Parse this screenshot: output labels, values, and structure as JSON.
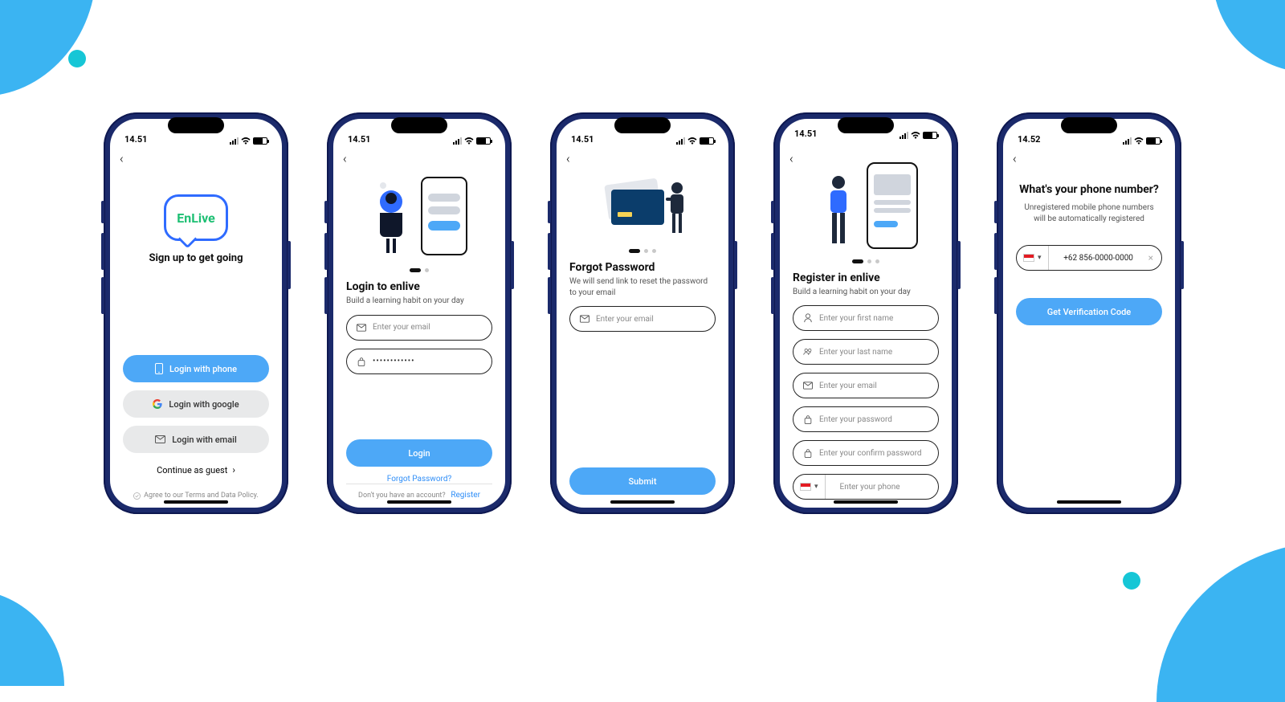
{
  "status": {
    "time1": "14.51",
    "time2": "14.52"
  },
  "colors": {
    "primary": "#4DA8F7",
    "accent": "#2F6BFF",
    "grey": "#E8E9EA"
  },
  "screen1": {
    "logo": "EnLive",
    "headline": "Sign up to get going",
    "login_phone": "Login with phone",
    "login_google": "Login with google",
    "login_email": "Login with email",
    "guest": "Continue as guest",
    "terms": "Agree to our Terms and Data Policy."
  },
  "screen2": {
    "title": "Login to enlive",
    "subtitle": "Build a learning habit on your day",
    "email_placeholder": "Enter your email",
    "password_masked": "••••••••••••",
    "login_btn": "Login",
    "forgot": "Forgot Password?",
    "no_account": "Don't you have an account?",
    "register": "Register"
  },
  "screen3": {
    "title": "Forgot Password",
    "subtitle": "We will send link to reset the password to your email",
    "email_placeholder": "Enter your email",
    "submit_btn": "Submit"
  },
  "screen4": {
    "title": "Register in enlive",
    "subtitle": "Build a learning habit on your day",
    "first_name_placeholder": "Enter your first name",
    "last_name_placeholder": "Enter your last name",
    "email_placeholder": "Enter your email",
    "password_placeholder": "Enter your password",
    "confirm_placeholder": "Enter your confirm password",
    "phone_placeholder": "Enter your phone"
  },
  "screen5": {
    "title": "What's your phone number?",
    "subtitle": "Unregistered mobile phone numbers will be automatically registered",
    "phone_value": "+62 856-0000-0000",
    "verify_btn": "Get Verification Code"
  }
}
